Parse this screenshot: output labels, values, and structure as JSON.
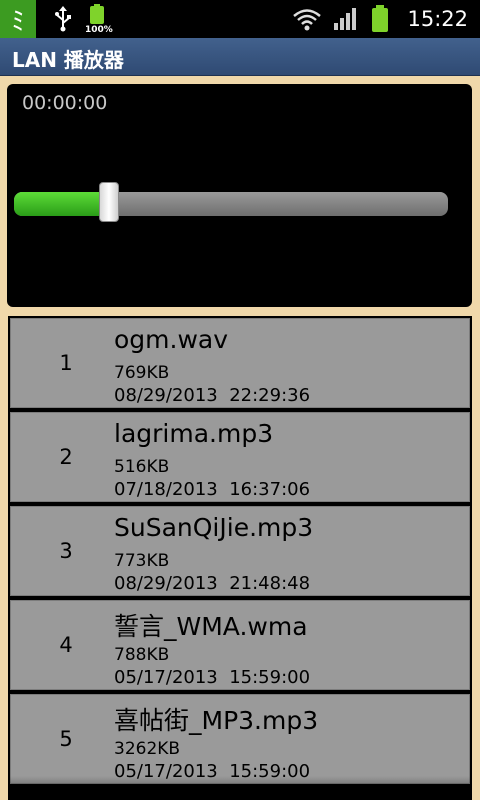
{
  "status_bar": {
    "app_icon_glyph": "ﾐ",
    "battery_small_label": "100%",
    "time": "15:22",
    "icons": [
      "app-notification-icon",
      "usb-icon",
      "battery-full-icon",
      "wifi-icon",
      "signal-icon",
      "battery-icon"
    ]
  },
  "title_bar": {
    "title": "LAN 播放器"
  },
  "player": {
    "time": "00:00:00",
    "seek_progress": 0.22,
    "colors": {
      "fill": "#3fbf2a",
      "track": "#808080"
    }
  },
  "files": [
    {
      "index": "1",
      "name": "ogm.wav",
      "size": "769KB",
      "date": "08/29/2013  22:29:36"
    },
    {
      "index": "2",
      "name": "lagrima.mp3",
      "size": "516KB",
      "date": "07/18/2013  16:37:06"
    },
    {
      "index": "3",
      "name": "SuSanQiJie.mp3",
      "size": "773KB",
      "date": "08/29/2013  21:48:48"
    },
    {
      "index": "4",
      "name": "誓言_WMA.wma",
      "size": "788KB",
      "date": "05/17/2013  15:59:00"
    },
    {
      "index": "5",
      "name": "喜帖街_MP3.mp3",
      "size": "3262KB",
      "date": "05/17/2013  15:59:00"
    }
  ]
}
